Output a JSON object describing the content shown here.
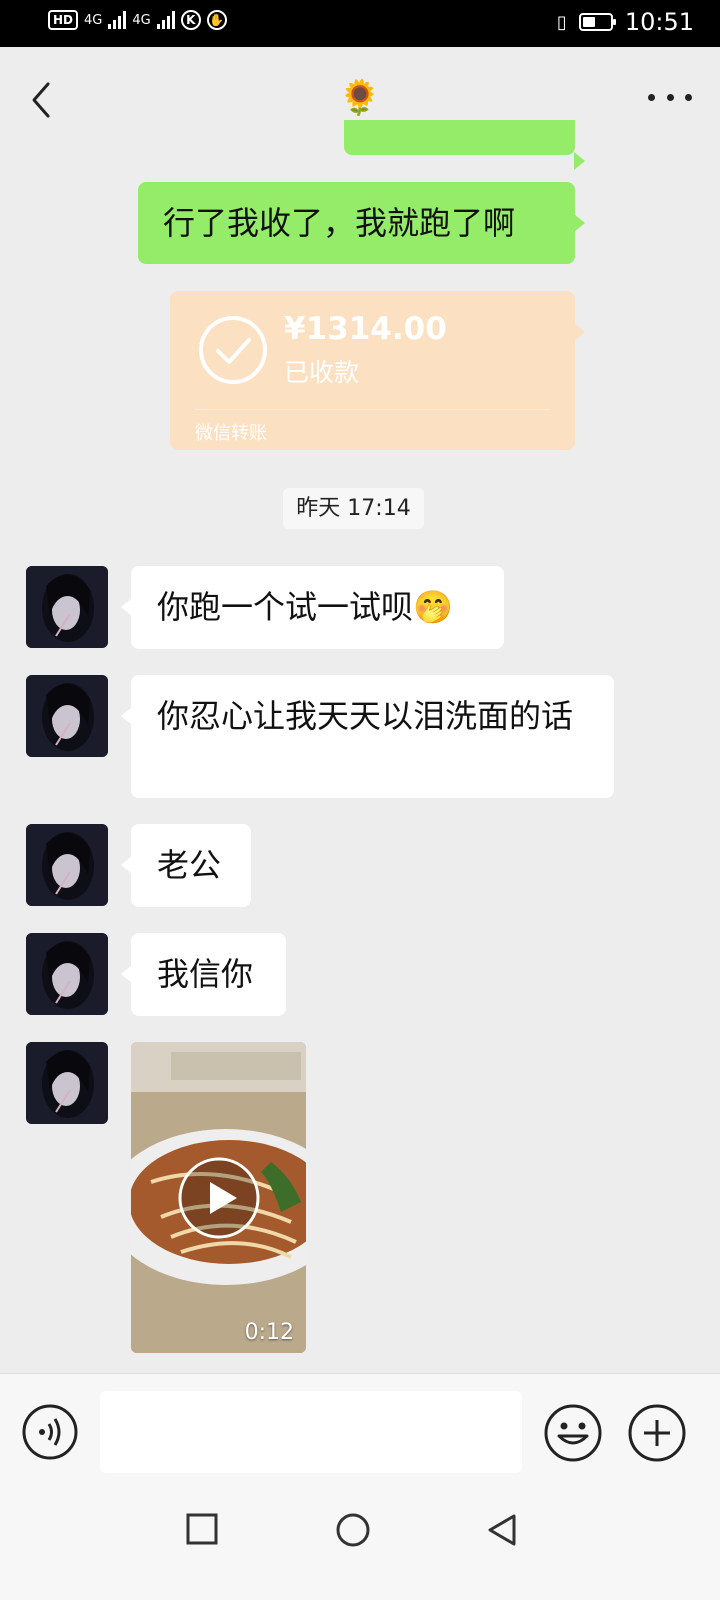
{
  "status_bar": {
    "left_chip": "HD",
    "network_1": "4G",
    "network_2": "4G",
    "time": "10:51",
    "battery_level": 0.45
  },
  "nav": {
    "title": "🌻",
    "back_icon": "chevron-left-icon",
    "more_icon": "more-dots-icon"
  },
  "messages": [
    {
      "side": "right",
      "type": "text",
      "text": "行了我收了，我就跑了啊"
    },
    {
      "side": "right",
      "type": "transfer",
      "amount": "¥1314.00",
      "status": "已收款",
      "label": "微信转账"
    },
    {
      "type": "timestamp",
      "text": "昨天 17:14"
    },
    {
      "side": "left",
      "type": "text",
      "text": "你跑一个试一试呗",
      "emoji": "🤭"
    },
    {
      "side": "left",
      "type": "text",
      "text": "你忍心让我天天以泪洗面的话"
    },
    {
      "side": "left",
      "type": "text",
      "text": "老公"
    },
    {
      "side": "left",
      "type": "text",
      "text": "我信你"
    },
    {
      "side": "left",
      "type": "video",
      "duration": "0:12"
    }
  ],
  "input_bar": {
    "value": "",
    "voice_icon": "voice-icon",
    "emoji_icon": "emoji-icon",
    "plus_icon": "plus-icon"
  },
  "colors": {
    "bubble_self": "#95ec69",
    "bubble_other": "#ffffff",
    "transfer_received": "#fce0c2",
    "background": "#ededed"
  }
}
